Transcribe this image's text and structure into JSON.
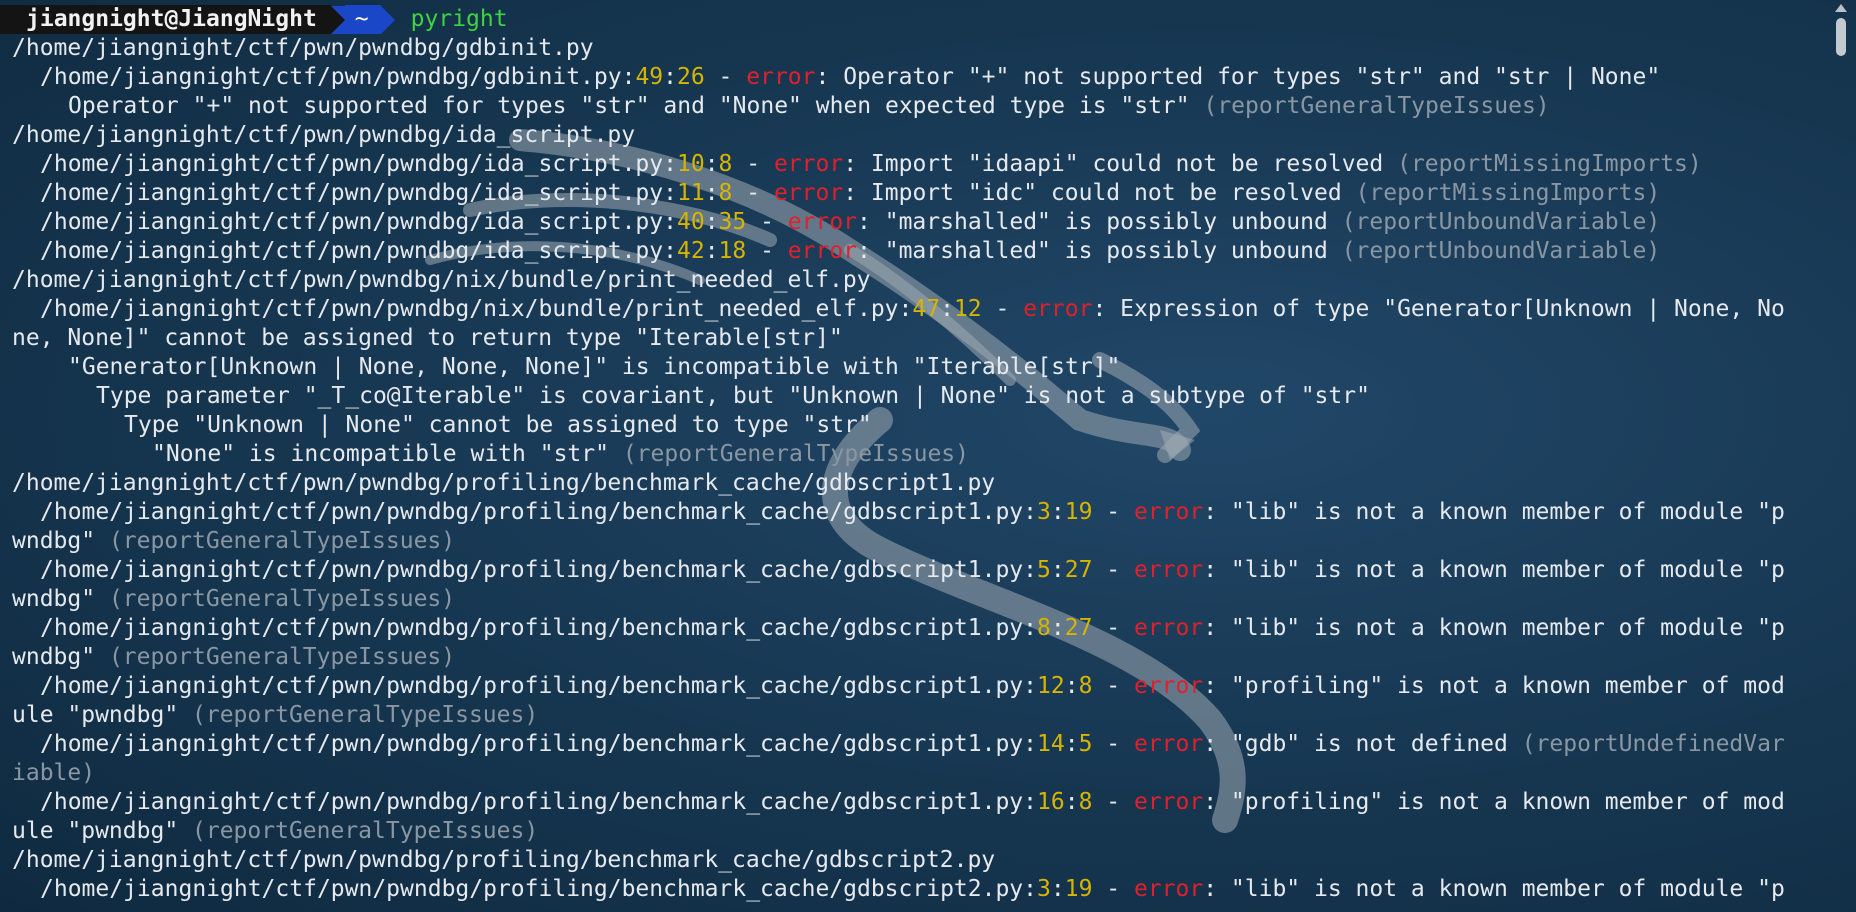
{
  "prompt": {
    "user_host": "jiangnight@JiangNight",
    "directory": "~",
    "command": "pyright"
  },
  "lines": [
    {
      "indent": 0,
      "parts": [
        {
          "t": "path",
          "s": "/home/jiangnight/ctf/pwn/pwndbg/gdbinit.py"
        }
      ]
    },
    {
      "indent": 1,
      "parts": [
        {
          "t": "path",
          "s": "/home/jiangnight/ctf/pwn/pwndbg/gdbinit.py:"
        },
        {
          "t": "num",
          "s": "49"
        },
        {
          "t": "path",
          "s": ":"
        },
        {
          "t": "num",
          "s": "26"
        },
        {
          "t": "path",
          "s": " - "
        },
        {
          "t": "err",
          "s": "error"
        },
        {
          "t": "path",
          "s": ": Operator \"+\" not supported for types \"str\" and \"str | None\""
        }
      ]
    },
    {
      "indent": 2,
      "parts": [
        {
          "t": "path",
          "s": "Operator \"+\" not supported for types \"str\" and \"None\" when expected type is \"str\" "
        },
        {
          "t": "rule",
          "s": "(reportGeneralTypeIssues)"
        }
      ]
    },
    {
      "indent": 0,
      "parts": [
        {
          "t": "path",
          "s": "/home/jiangnight/ctf/pwn/pwndbg/ida_script.py"
        }
      ]
    },
    {
      "indent": 1,
      "parts": [
        {
          "t": "path",
          "s": "/home/jiangnight/ctf/pwn/pwndbg/ida_script.py:"
        },
        {
          "t": "num",
          "s": "10"
        },
        {
          "t": "path",
          "s": ":"
        },
        {
          "t": "num",
          "s": "8"
        },
        {
          "t": "path",
          "s": " - "
        },
        {
          "t": "err",
          "s": "error"
        },
        {
          "t": "path",
          "s": ": Import \"idaapi\" could not be resolved "
        },
        {
          "t": "rule",
          "s": "(reportMissingImports)"
        }
      ]
    },
    {
      "indent": 1,
      "parts": [
        {
          "t": "path",
          "s": "/home/jiangnight/ctf/pwn/pwndbg/ida_script.py:"
        },
        {
          "t": "num",
          "s": "11"
        },
        {
          "t": "path",
          "s": ":"
        },
        {
          "t": "num",
          "s": "8"
        },
        {
          "t": "path",
          "s": " - "
        },
        {
          "t": "err",
          "s": "error"
        },
        {
          "t": "path",
          "s": ": Import \"idc\" could not be resolved "
        },
        {
          "t": "rule",
          "s": "(reportMissingImports)"
        }
      ]
    },
    {
      "indent": 1,
      "parts": [
        {
          "t": "path",
          "s": "/home/jiangnight/ctf/pwn/pwndbg/ida_script.py:"
        },
        {
          "t": "num",
          "s": "40"
        },
        {
          "t": "path",
          "s": ":"
        },
        {
          "t": "num",
          "s": "35"
        },
        {
          "t": "path",
          "s": " - "
        },
        {
          "t": "err",
          "s": "error"
        },
        {
          "t": "path",
          "s": ": \"marshalled\" is possibly unbound "
        },
        {
          "t": "rule",
          "s": "(reportUnboundVariable)"
        }
      ]
    },
    {
      "indent": 1,
      "parts": [
        {
          "t": "path",
          "s": "/home/jiangnight/ctf/pwn/pwndbg/ida_script.py:"
        },
        {
          "t": "num",
          "s": "42"
        },
        {
          "t": "path",
          "s": ":"
        },
        {
          "t": "num",
          "s": "18"
        },
        {
          "t": "path",
          "s": " - "
        },
        {
          "t": "err",
          "s": "error"
        },
        {
          "t": "path",
          "s": ": \"marshalled\" is possibly unbound "
        },
        {
          "t": "rule",
          "s": "(reportUnboundVariable)"
        }
      ]
    },
    {
      "indent": 0,
      "parts": [
        {
          "t": "path",
          "s": "/home/jiangnight/ctf/pwn/pwndbg/nix/bundle/print_needed_elf.py"
        }
      ]
    },
    {
      "indent": 1,
      "parts": [
        {
          "t": "path",
          "s": "/home/jiangnight/ctf/pwn/pwndbg/nix/bundle/print_needed_elf.py:"
        },
        {
          "t": "num",
          "s": "47"
        },
        {
          "t": "path",
          "s": ":"
        },
        {
          "t": "num",
          "s": "12"
        },
        {
          "t": "path",
          "s": " - "
        },
        {
          "t": "err",
          "s": "error"
        },
        {
          "t": "path",
          "s": ": Expression of type \"Generator[Unknown | None, No"
        }
      ]
    },
    {
      "indent": 0,
      "parts": [
        {
          "t": "path",
          "s": "ne, None]\" cannot be assigned to return type \"Iterable[str]\""
        }
      ]
    },
    {
      "indent": 2,
      "parts": [
        {
          "t": "path",
          "s": "\"Generator[Unknown | None, None, None]\" is incompatible with \"Iterable[str]\""
        }
      ]
    },
    {
      "indent": 3,
      "parts": [
        {
          "t": "path",
          "s": "Type parameter \"_T_co@Iterable\" is covariant, but \"Unknown | None\" is not a subtype of \"str\""
        }
      ]
    },
    {
      "indent": 4,
      "parts": [
        {
          "t": "path",
          "s": "Type \"Unknown | None\" cannot be assigned to type \"str\""
        }
      ]
    },
    {
      "indent": 5,
      "parts": [
        {
          "t": "path",
          "s": "\"None\" is incompatible with \"str\" "
        },
        {
          "t": "rule",
          "s": "(reportGeneralTypeIssues)"
        }
      ]
    },
    {
      "indent": 0,
      "parts": [
        {
          "t": "path",
          "s": "/home/jiangnight/ctf/pwn/pwndbg/profiling/benchmark_cache/gdbscript1.py"
        }
      ]
    },
    {
      "indent": 1,
      "parts": [
        {
          "t": "path",
          "s": "/home/jiangnight/ctf/pwn/pwndbg/profiling/benchmark_cache/gdbscript1.py:"
        },
        {
          "t": "num",
          "s": "3"
        },
        {
          "t": "path",
          "s": ":"
        },
        {
          "t": "num",
          "s": "19"
        },
        {
          "t": "path",
          "s": " - "
        },
        {
          "t": "err",
          "s": "error"
        },
        {
          "t": "path",
          "s": ": \"lib\" is not a known member of module \"p"
        }
      ]
    },
    {
      "indent": 0,
      "parts": [
        {
          "t": "path",
          "s": "wndbg\" "
        },
        {
          "t": "rule",
          "s": "(reportGeneralTypeIssues)"
        }
      ]
    },
    {
      "indent": 1,
      "parts": [
        {
          "t": "path",
          "s": "/home/jiangnight/ctf/pwn/pwndbg/profiling/benchmark_cache/gdbscript1.py:"
        },
        {
          "t": "num",
          "s": "5"
        },
        {
          "t": "path",
          "s": ":"
        },
        {
          "t": "num",
          "s": "27"
        },
        {
          "t": "path",
          "s": " - "
        },
        {
          "t": "err",
          "s": "error"
        },
        {
          "t": "path",
          "s": ": \"lib\" is not a known member of module \"p"
        }
      ]
    },
    {
      "indent": 0,
      "parts": [
        {
          "t": "path",
          "s": "wndbg\" "
        },
        {
          "t": "rule",
          "s": "(reportGeneralTypeIssues)"
        }
      ]
    },
    {
      "indent": 1,
      "parts": [
        {
          "t": "path",
          "s": "/home/jiangnight/ctf/pwn/pwndbg/profiling/benchmark_cache/gdbscript1.py:"
        },
        {
          "t": "num",
          "s": "8"
        },
        {
          "t": "path",
          "s": ":"
        },
        {
          "t": "num",
          "s": "27"
        },
        {
          "t": "path",
          "s": " - "
        },
        {
          "t": "err",
          "s": "error"
        },
        {
          "t": "path",
          "s": ": \"lib\" is not a known member of module \"p"
        }
      ]
    },
    {
      "indent": 0,
      "parts": [
        {
          "t": "path",
          "s": "wndbg\" "
        },
        {
          "t": "rule",
          "s": "(reportGeneralTypeIssues)"
        }
      ]
    },
    {
      "indent": 1,
      "parts": [
        {
          "t": "path",
          "s": "/home/jiangnight/ctf/pwn/pwndbg/profiling/benchmark_cache/gdbscript1.py:"
        },
        {
          "t": "num",
          "s": "12"
        },
        {
          "t": "path",
          "s": ":"
        },
        {
          "t": "num",
          "s": "8"
        },
        {
          "t": "path",
          "s": " - "
        },
        {
          "t": "err",
          "s": "error"
        },
        {
          "t": "path",
          "s": ": \"profiling\" is not a known member of mod"
        }
      ]
    },
    {
      "indent": 0,
      "parts": [
        {
          "t": "path",
          "s": "ule \"pwndbg\" "
        },
        {
          "t": "rule",
          "s": "(reportGeneralTypeIssues)"
        }
      ]
    },
    {
      "indent": 1,
      "parts": [
        {
          "t": "path",
          "s": "/home/jiangnight/ctf/pwn/pwndbg/profiling/benchmark_cache/gdbscript1.py:"
        },
        {
          "t": "num",
          "s": "14"
        },
        {
          "t": "path",
          "s": ":"
        },
        {
          "t": "num",
          "s": "5"
        },
        {
          "t": "path",
          "s": " - "
        },
        {
          "t": "err",
          "s": "error"
        },
        {
          "t": "path",
          "s": ": \"gdb\" is not defined "
        },
        {
          "t": "rule",
          "s": "(reportUndefinedVar"
        }
      ]
    },
    {
      "indent": 0,
      "parts": [
        {
          "t": "rule",
          "s": "iable)"
        }
      ]
    },
    {
      "indent": 1,
      "parts": [
        {
          "t": "path",
          "s": "/home/jiangnight/ctf/pwn/pwndbg/profiling/benchmark_cache/gdbscript1.py:"
        },
        {
          "t": "num",
          "s": "16"
        },
        {
          "t": "path",
          "s": ":"
        },
        {
          "t": "num",
          "s": "8"
        },
        {
          "t": "path",
          "s": " - "
        },
        {
          "t": "err",
          "s": "error"
        },
        {
          "t": "path",
          "s": ": \"profiling\" is not a known member of mod"
        }
      ]
    },
    {
      "indent": 0,
      "parts": [
        {
          "t": "path",
          "s": "ule \"pwndbg\" "
        },
        {
          "t": "rule",
          "s": "(reportGeneralTypeIssues)"
        }
      ]
    },
    {
      "indent": 0,
      "parts": [
        {
          "t": "path",
          "s": "/home/jiangnight/ctf/pwn/pwndbg/profiling/benchmark_cache/gdbscript2.py"
        }
      ]
    },
    {
      "indent": 1,
      "parts": [
        {
          "t": "path",
          "s": "/home/jiangnight/ctf/pwn/pwndbg/profiling/benchmark_cache/gdbscript2.py:"
        },
        {
          "t": "num",
          "s": "3"
        },
        {
          "t": "path",
          "s": ":"
        },
        {
          "t": "num",
          "s": "19"
        },
        {
          "t": "path",
          "s": " - "
        },
        {
          "t": "err",
          "s": "error"
        },
        {
          "t": "path",
          "s": ": \"lib\" is not a known member of module \"p"
        }
      ]
    }
  ],
  "colors": {
    "text": "#e6e9ee",
    "line_number": "#d7b400",
    "error": "#e0202a",
    "rule_name": "#8a97a3",
    "command": "#3fd43f",
    "prompt_user_bg": "#141414",
    "prompt_dir_bg": "#1a46c8",
    "background": "#163650"
  }
}
